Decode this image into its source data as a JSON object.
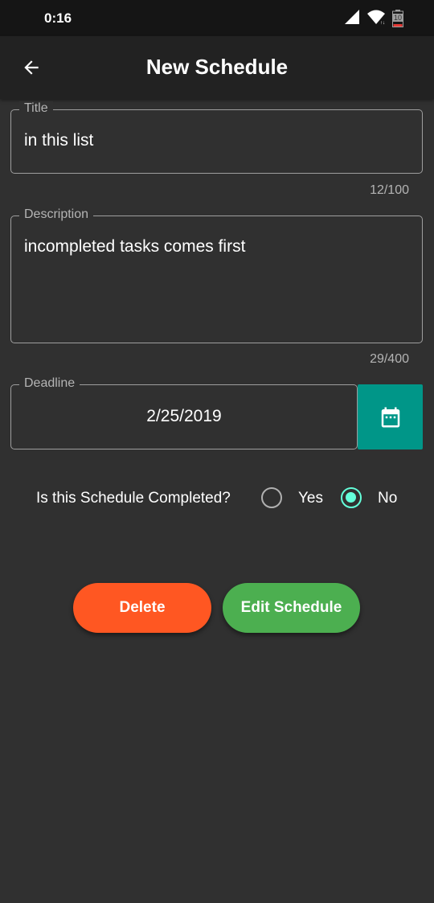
{
  "status_bar": {
    "time": "0:16",
    "battery_level": "10",
    "icons": [
      "signal-icon",
      "wifi-icon",
      "battery-icon"
    ]
  },
  "app_bar": {
    "title": "New Schedule",
    "back_icon": "arrow-left-icon"
  },
  "form": {
    "title": {
      "label": "Title",
      "value": "in this list",
      "counter": "12/100"
    },
    "description": {
      "label": "Description",
      "value": "incompleted tasks comes first",
      "counter": "29/400"
    },
    "deadline": {
      "label": "Deadline",
      "value": "2/25/2019",
      "picker_icon": "calendar-icon"
    },
    "completed": {
      "question": "Is this Schedule Completed?",
      "options": [
        {
          "label": "Yes",
          "selected": false
        },
        {
          "label": "No",
          "selected": true
        }
      ]
    }
  },
  "actions": {
    "delete_label": "Delete",
    "edit_label": "Edit Schedule"
  },
  "colors": {
    "background": "#303030",
    "app_bar": "#222222",
    "accent_teal": "#009688",
    "radio_selected": "#64ffda",
    "delete": "#ff5722",
    "edit": "#4caf50"
  }
}
